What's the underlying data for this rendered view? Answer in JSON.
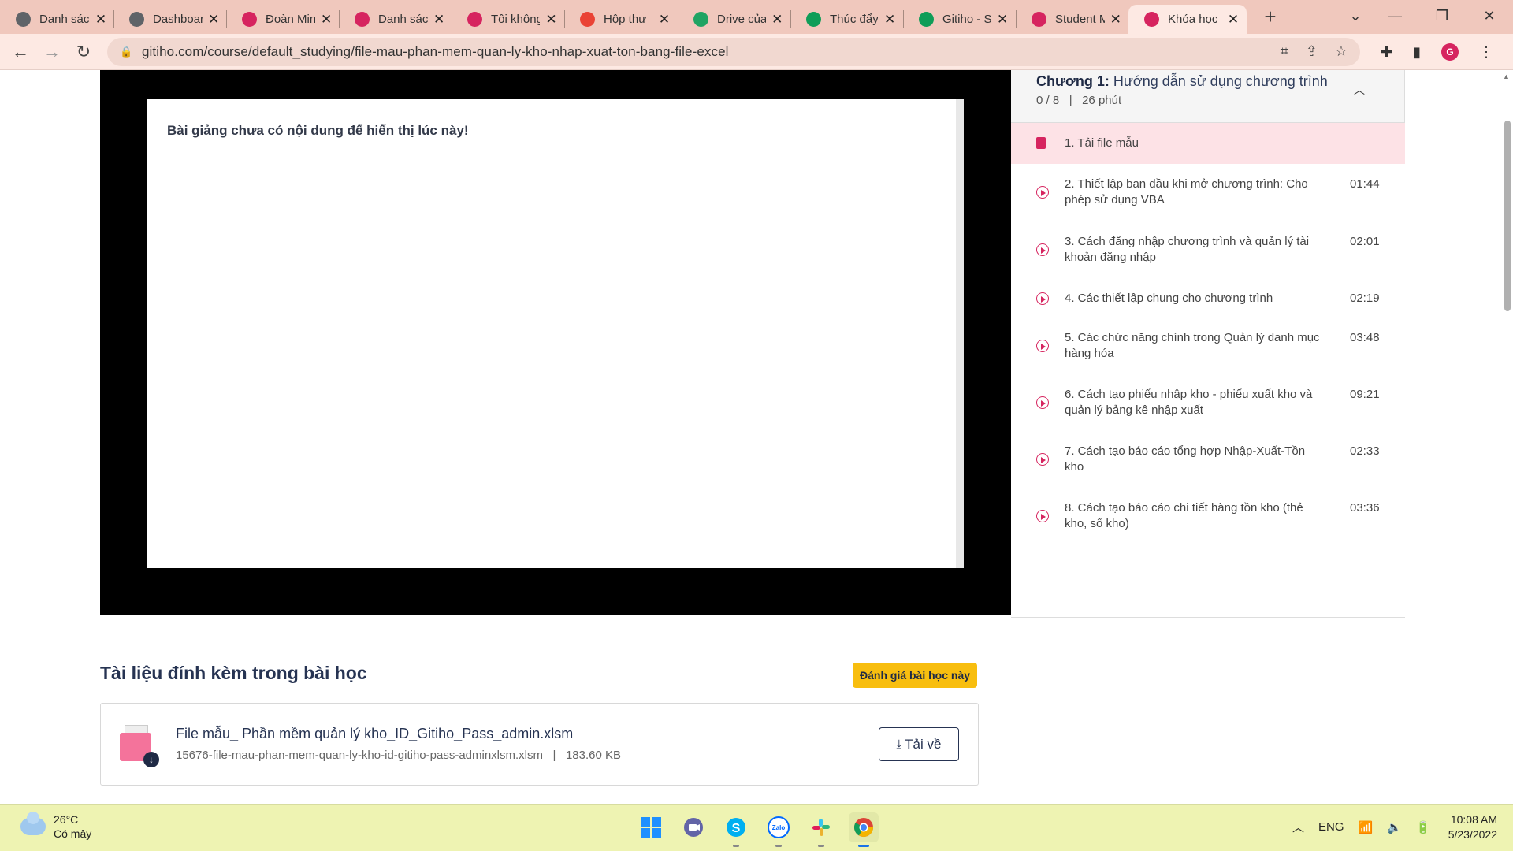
{
  "browser": {
    "tabs": [
      {
        "title": "Danh sách",
        "fav": "globe-icon",
        "color": "#5f6368"
      },
      {
        "title": "Dashboard",
        "fav": "globe-icon",
        "color": "#5f6368"
      },
      {
        "title": "Đoàn Minh",
        "fav": "gitiho-icon",
        "color": "#d6245f"
      },
      {
        "title": "Danh sách",
        "fav": "gitiho-icon",
        "color": "#d6245f"
      },
      {
        "title": "Tôi không",
        "fav": "gitiho-small-icon",
        "color": "#d6245f"
      },
      {
        "title": "Hộp thư",
        "fav": "gmail-icon",
        "color": "#ea4335"
      },
      {
        "title": "Drive của",
        "fav": "drive-icon",
        "color": "#1fa463"
      },
      {
        "title": "Thúc đẩy",
        "fav": "sheets-icon",
        "color": "#0f9d58"
      },
      {
        "title": "Gitiho - S",
        "fav": "sheets-icon",
        "color": "#0f9d58"
      },
      {
        "title": "Student M",
        "fav": "gitiho-icon",
        "color": "#d6245f"
      },
      {
        "title": "Khóa học",
        "fav": "gitiho-icon",
        "color": "#d6245f",
        "active": true
      }
    ],
    "url": "gitiho.com/course/default_studying/file-mau-phan-mem-quan-ly-kho-nhap-xuat-ton-bang-file-excel"
  },
  "player": {
    "message": "Bài giảng chưa có nội dung để hiển thị lúc này!"
  },
  "chapter": {
    "label": "Chương 1:",
    "title": "Hướng dẫn sử dụng chương trình",
    "progress": "0 / 8",
    "duration": "26 phút"
  },
  "lessons": [
    {
      "text": "1. Tải file mẫu",
      "duration": "",
      "type": "document",
      "active": true
    },
    {
      "text": "2. Thiết lập ban đầu khi mở chương trình: Cho phép sử dụng VBA",
      "duration": "01:44",
      "type": "video"
    },
    {
      "text": "3. Cách đăng nhập chương trình và quản lý tài khoản đăng nhập",
      "duration": "02:01",
      "type": "video"
    },
    {
      "text": "4. Các thiết lập chung cho chương trình",
      "duration": "02:19",
      "type": "video"
    },
    {
      "text": "5. Các chức năng chính trong Quản lý danh mục hàng hóa",
      "duration": "03:48",
      "type": "video"
    },
    {
      "text": "6. Cách tạo phiếu nhập kho - phiếu xuất kho và quản lý bảng kê nhập xuất",
      "duration": "09:21",
      "type": "video"
    },
    {
      "text": "7. Cách tạo báo cáo tổng hợp Nhập-Xuất-Tồn kho",
      "duration": "02:33",
      "type": "video"
    },
    {
      "text": "8. Cách tạo báo cáo chi tiết hàng tồn kho (thẻ kho, sổ kho)",
      "duration": "03:36",
      "type": "video"
    }
  ],
  "attachments": {
    "heading": "Tài liệu đính kèm trong bài học",
    "rate_label": "Đánh giá bài học này",
    "file": {
      "name": "File mẫu_ Phần mềm quản lý kho_ID_Gitiho_Pass_admin.xlsm",
      "filename": "15676-file-mau-phan-mem-quan-ly-kho-id-gitiho-pass-adminxlsm.xlsm",
      "separator": "|",
      "size": "183.60 KB",
      "download_label": "Tải về"
    }
  },
  "taskbar": {
    "temp": "26°C",
    "weather": "Có mây",
    "lang": "ENG",
    "time": "10:08 AM",
    "date": "5/23/2022"
  }
}
